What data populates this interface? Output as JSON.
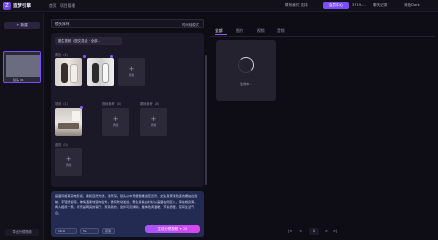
{
  "header": {
    "brand": "造梦引擎",
    "nav": [
      "首页",
      "项目管理"
    ],
    "right": {
      "contact": "联系我们 支持",
      "vip": "会员中心",
      "user": "3719....",
      "time": "聊天记录",
      "mode": "深色Dark"
    }
  },
  "sidebar": {
    "new_btn": "+ 新建",
    "section_label": "分镜列表",
    "thumb_caption": "镜头 01",
    "footer_btn": "导出分镜视频"
  },
  "main": {
    "dropdown_value": "镜头序列",
    "dropdown_right": "时间轴模式",
    "chip": "图生视频（图文混合 · 全部...",
    "labels": {
      "characters": "角色（4）",
      "scene": "场景（1）",
      "first_frame": "首帧参考（0）",
      "last_frame": "尾帧参考（0）",
      "props": "道具（0）"
    },
    "add_label": "添加"
  },
  "prompt": {
    "text": "画面风格真实电影感，柔和自然光线，浅景深。镜头从中景缓慢推进至近景，女生身穿浅色连衣裙站在窗前，手轻抚窗帘，神情温柔地望向窗外，微风吹动发丝。男生身着白衬衫从画面右侧走入，停在她身旁，两人相视一笑。背景是明亮的客厅，家具简约，窗外可见绿树。整体色调温暖，节奏舒缓，富有生活气息。",
    "btn1": "16:9",
    "btn2": "5s",
    "btn3": "高清",
    "generate": "生成分镜视频 ✦ 20"
  },
  "right_panel": {
    "tabs": [
      "全部",
      "图片",
      "视频",
      "音频"
    ],
    "loading_text": "生成中..."
  },
  "pagination": {
    "prev": "<",
    "current": "1",
    "next": ">",
    "first": "|<",
    "last": ">|"
  }
}
